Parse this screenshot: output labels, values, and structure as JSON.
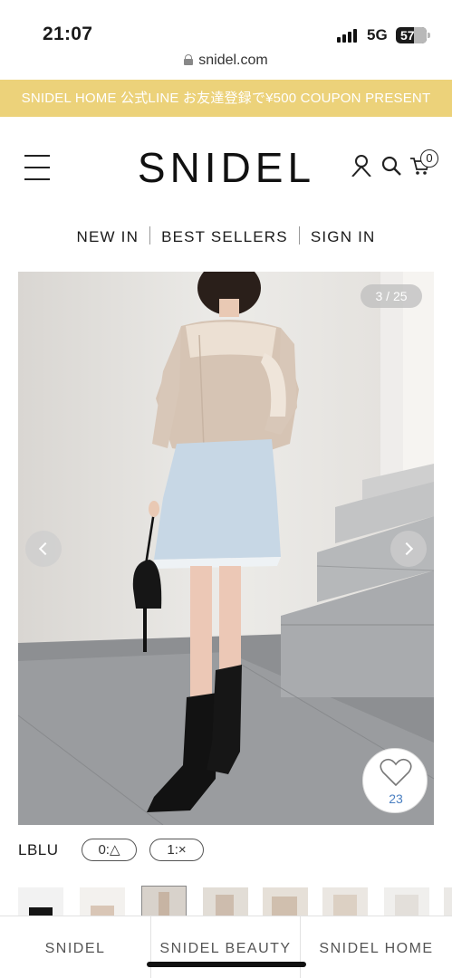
{
  "status_bar": {
    "time": "21:07",
    "network": "5G",
    "battery": "57"
  },
  "browser": {
    "url": "snidel.com"
  },
  "promo": {
    "text": "SNIDEL HOME  公式LINE  お友達登録で¥500 COUPON PRESENT",
    "background": "#ecd27a"
  },
  "header": {
    "logo": "SNIDEL",
    "cart_count": "0",
    "icons": [
      "menu-icon",
      "account-icon",
      "search-icon",
      "cart-icon"
    ]
  },
  "nav": {
    "items": [
      "NEW IN",
      "BEST SELLERS",
      "SIGN IN"
    ]
  },
  "gallery": {
    "counter": "3 / 25",
    "favorite_count": "23",
    "icons": [
      "chevron-left-icon",
      "chevron-right-icon",
      "heart-icon"
    ]
  },
  "product": {
    "color": "LBLU",
    "sizes": [
      "0:△",
      "1:×"
    ]
  },
  "bottom_tabs": {
    "items": [
      "SNIDEL",
      "SNIDEL BEAUTY",
      "SNIDEL HOME"
    ],
    "active_index": 1
  }
}
